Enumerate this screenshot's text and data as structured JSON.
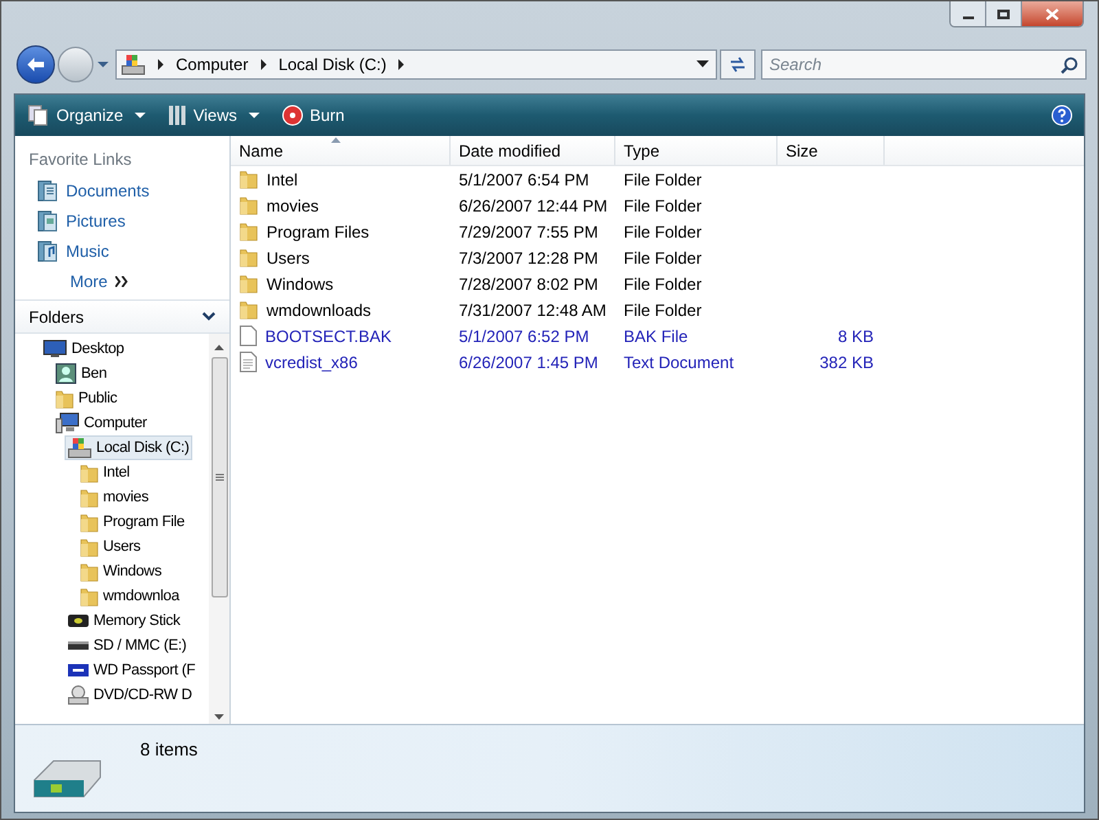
{
  "address_bar": {
    "segments": [
      "Computer",
      "Local Disk (C:)"
    ]
  },
  "search": {
    "placeholder": "Search"
  },
  "toolbar": {
    "buttons": [
      {
        "label": "Organize",
        "kind": "organize"
      },
      {
        "label": "Views",
        "kind": "views"
      },
      {
        "label": "Burn",
        "kind": "burn"
      }
    ]
  },
  "favorite_links": {
    "title": "Favorite Links",
    "items": [
      {
        "label": "Documents",
        "kind": "documents"
      },
      {
        "label": "Pictures",
        "kind": "pictures"
      },
      {
        "label": "Music",
        "kind": "music"
      }
    ],
    "more": "More"
  },
  "folders": {
    "title": "Folders",
    "expanded": true,
    "tree": [
      {
        "label": "Desktop",
        "kind": "desktop",
        "selected": false,
        "children": [
          {
            "label": "Ben",
            "kind": "user",
            "selected": false
          },
          {
            "label": "Public",
            "kind": "folder",
            "selected": false
          },
          {
            "label": "Computer",
            "kind": "computer",
            "selected": false,
            "children": [
              {
                "label": "Local Disk (C:)",
                "kind": "disk",
                "selected": true,
                "children": [
                  {
                    "label": "Intel",
                    "kind": "folder",
                    "selected": false
                  },
                  {
                    "label": "movies",
                    "kind": "folder",
                    "selected": false
                  },
                  {
                    "label": "Program File",
                    "kind": "folder",
                    "selected": false
                  },
                  {
                    "label": "Users",
                    "kind": "folder",
                    "selected": false
                  },
                  {
                    "label": "Windows",
                    "kind": "folder",
                    "selected": false
                  },
                  {
                    "label": "wmdownloa",
                    "kind": "folder",
                    "selected": false
                  }
                ]
              },
              {
                "label": "Memory Stick",
                "kind": "memory-stick",
                "selected": false
              },
              {
                "label": "SD / MMC (E:)",
                "kind": "card-reader",
                "selected": false
              },
              {
                "label": "WD Passport (F",
                "kind": "external-drive",
                "selected": false
              },
              {
                "label": "DVD/CD-RW D",
                "kind": "dvd",
                "selected": false
              }
            ]
          }
        ]
      }
    ]
  },
  "file_list": {
    "columns": [
      {
        "label": "Name",
        "sorted": true
      },
      {
        "label": "Date modified",
        "sorted": false
      },
      {
        "label": "Type",
        "sorted": false
      },
      {
        "label": "Size",
        "sorted": false
      }
    ],
    "rows": [
      {
        "name": "Intel",
        "date": "5/1/2007 6:54 PM",
        "type": "File Folder",
        "kind": "folder",
        "compressed": false
      },
      {
        "name": "movies",
        "date": "6/26/2007 12:44 PM",
        "type": "File Folder",
        "kind": "folder",
        "compressed": false
      },
      {
        "name": "Program Files",
        "date": "7/29/2007 7:55 PM",
        "type": "File Folder",
        "kind": "folder",
        "compressed": false
      },
      {
        "name": "Users",
        "date": "7/3/2007 12:28 PM",
        "type": "File Folder",
        "kind": "folder",
        "compressed": false
      },
      {
        "name": "Windows",
        "date": "7/28/2007 8:02 PM",
        "type": "File Folder",
        "kind": "folder",
        "compressed": false
      },
      {
        "name": "wmdownloads",
        "date": "7/31/2007 12:48 AM",
        "type": "File Folder",
        "kind": "folder",
        "compressed": false
      },
      {
        "name": "BOOTSECT.BAK",
        "date": "5/1/2007 6:52 PM",
        "type": "BAK File",
        "size": "8 KB",
        "kind": "file",
        "compressed": true
      },
      {
        "name": "vcredist_x86",
        "date": "6/26/2007 1:45 PM",
        "type": "Text Document",
        "size": "382 KB",
        "kind": "text",
        "compressed": true
      }
    ]
  },
  "details_pane": {
    "count": "8 items"
  }
}
